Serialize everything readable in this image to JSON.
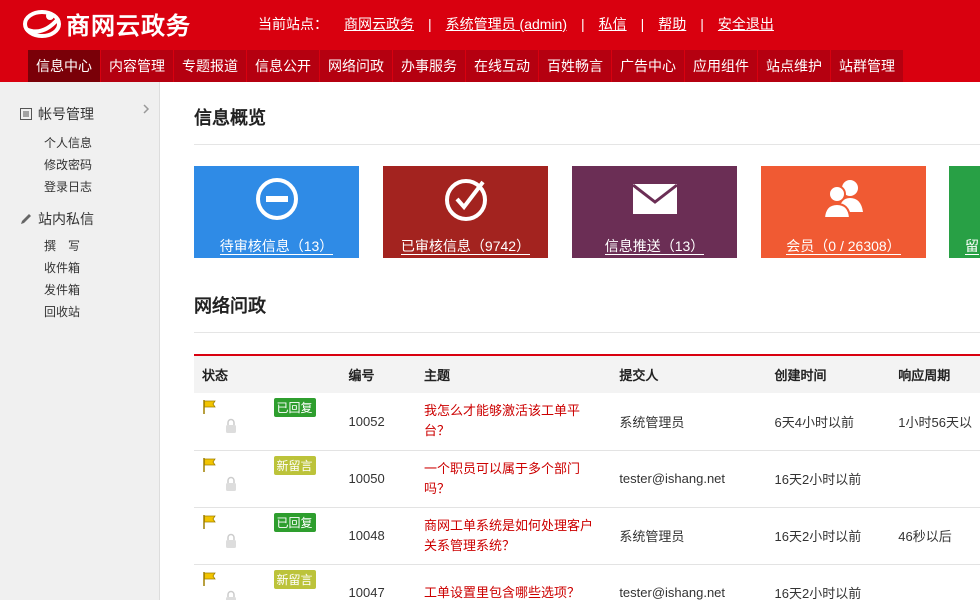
{
  "brand": {
    "name": "商网云政务"
  },
  "topbar": {
    "current_site_label": "当前站点：",
    "site_name": "商网云政务",
    "user": "系统管理员 (admin)",
    "messages": "私信",
    "help": "帮助",
    "logout": "安全退出"
  },
  "nav": [
    "信息中心",
    "内容管理",
    "专题报道",
    "信息公开",
    "网络问政",
    "办事服务",
    "在线互动",
    "百姓畅言",
    "广告中心",
    "应用组件",
    "站点维护",
    "站群管理"
  ],
  "sidebar": {
    "account": {
      "title": "帐号管理",
      "items": [
        "个人信息",
        "修改密码",
        "登录日志"
      ]
    },
    "messages": {
      "title": "站内私信",
      "items": [
        "撰　写",
        "收件箱",
        "发件箱",
        "回收站"
      ]
    }
  },
  "overview": {
    "title": "信息概览",
    "tiles": [
      {
        "label": "待审核信息（13）",
        "color": "#2f8be6",
        "icon": "minus-circle-icon"
      },
      {
        "label": "已审核信息（9742）",
        "color": "#a3231f",
        "icon": "check-circle-icon"
      },
      {
        "label": "信息推送（13）",
        "color": "#6b2e55",
        "icon": "envelope-icon"
      },
      {
        "label": "会员（0 / 26308）",
        "color": "#f05a33",
        "icon": "users-icon"
      },
      {
        "label": "留",
        "color": "#28a045",
        "icon": "tile-icon"
      }
    ]
  },
  "wenzheng": {
    "title": "网络问政",
    "columns": [
      "状态",
      "",
      "编号",
      "主题",
      "提交人",
      "创建时间",
      "响应周期"
    ],
    "rows": [
      {
        "badge": "已回复",
        "badge_color": "#2e9e2e",
        "id": "10052",
        "subject": "我怎么才能够激活该工单平台？",
        "submitter": "系统管理员",
        "created": "6天4小时以前",
        "response": "1小时56天以"
      },
      {
        "badge": "新留言",
        "badge_color": "#bcc33a",
        "id": "10050",
        "subject": "一个职员可以属于多个部门吗？",
        "submitter": "tester@ishang.net",
        "created": "16天2小时以前",
        "response": ""
      },
      {
        "badge": "已回复",
        "badge_color": "#2e9e2e",
        "id": "10048",
        "subject": "商网工单系统是如何处理客户关系管理系统？",
        "submitter": "系统管理员",
        "created": "16天2小时以前",
        "response": "46秒以后"
      },
      {
        "badge": "新留言",
        "badge_color": "#bcc33a",
        "id": "10047",
        "subject": "工单设置里包含哪些选项？",
        "submitter": "tester@ishang.net",
        "created": "16天2小时以前",
        "response": ""
      }
    ]
  }
}
